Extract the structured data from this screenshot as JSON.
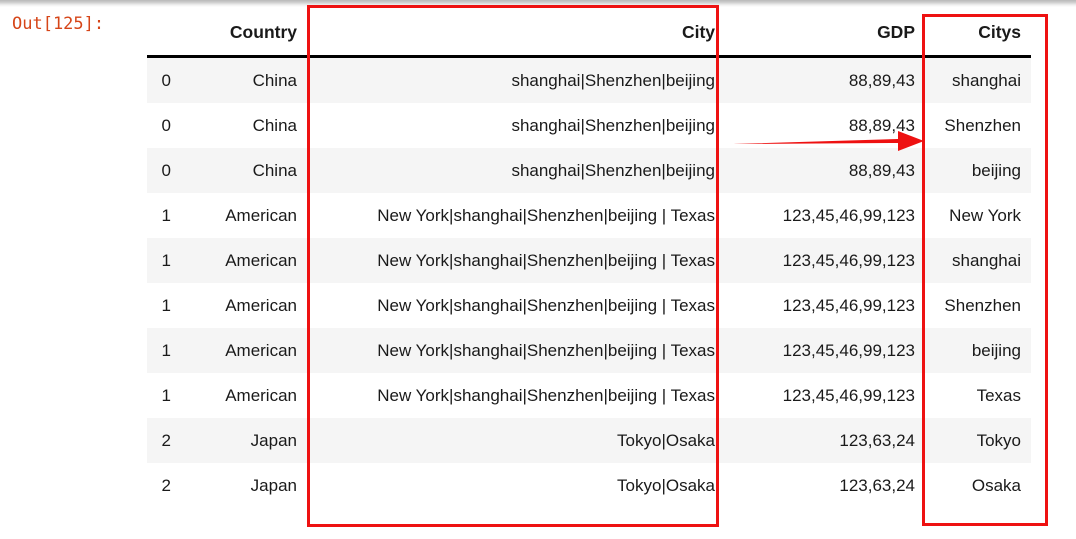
{
  "notebook": {
    "out_prompt": "Out[125]:",
    "prompt_color": "#d64518"
  },
  "table": {
    "columns": [
      "",
      "Country",
      "City",
      "GDP",
      "Citys"
    ],
    "rows": [
      {
        "index": "0",
        "country": "China",
        "city": "shanghai|Shenzhen|beijing",
        "gdp": "88,89,43",
        "citys": "shanghai"
      },
      {
        "index": "0",
        "country": "China",
        "city": "shanghai|Shenzhen|beijing",
        "gdp": "88,89,43",
        "citys": "Shenzhen"
      },
      {
        "index": "0",
        "country": "China",
        "city": "shanghai|Shenzhen|beijing",
        "gdp": "88,89,43",
        "citys": "beijing"
      },
      {
        "index": "1",
        "country": "American",
        "city": "New York|shanghai|Shenzhen|beijing | Texas",
        "gdp": "123,45,46,99,123",
        "citys": "New York"
      },
      {
        "index": "1",
        "country": "American",
        "city": "New York|shanghai|Shenzhen|beijing | Texas",
        "gdp": "123,45,46,99,123",
        "citys": "shanghai"
      },
      {
        "index": "1",
        "country": "American",
        "city": "New York|shanghai|Shenzhen|beijing | Texas",
        "gdp": "123,45,46,99,123",
        "citys": "Shenzhen"
      },
      {
        "index": "1",
        "country": "American",
        "city": "New York|shanghai|Shenzhen|beijing | Texas",
        "gdp": "123,45,46,99,123",
        "citys": "beijing"
      },
      {
        "index": "1",
        "country": "American",
        "city": "New York|shanghai|Shenzhen|beijing | Texas",
        "gdp": "123,45,46,99,123",
        "citys": "Texas"
      },
      {
        "index": "2",
        "country": "Japan",
        "city": "Tokyo|Osaka",
        "gdp": "123,63,24",
        "citys": "Tokyo"
      },
      {
        "index": "2",
        "country": "Japan",
        "city": "Tokyo|Osaka",
        "gdp": "123,63,24",
        "citys": "Osaka"
      }
    ]
  },
  "annotations": {
    "color": "#ee1111",
    "rect_city_label": "City column highlight",
    "rect_citys_label": "Citys column highlight",
    "arrow_label": "arrow pointing from City to Citys"
  }
}
